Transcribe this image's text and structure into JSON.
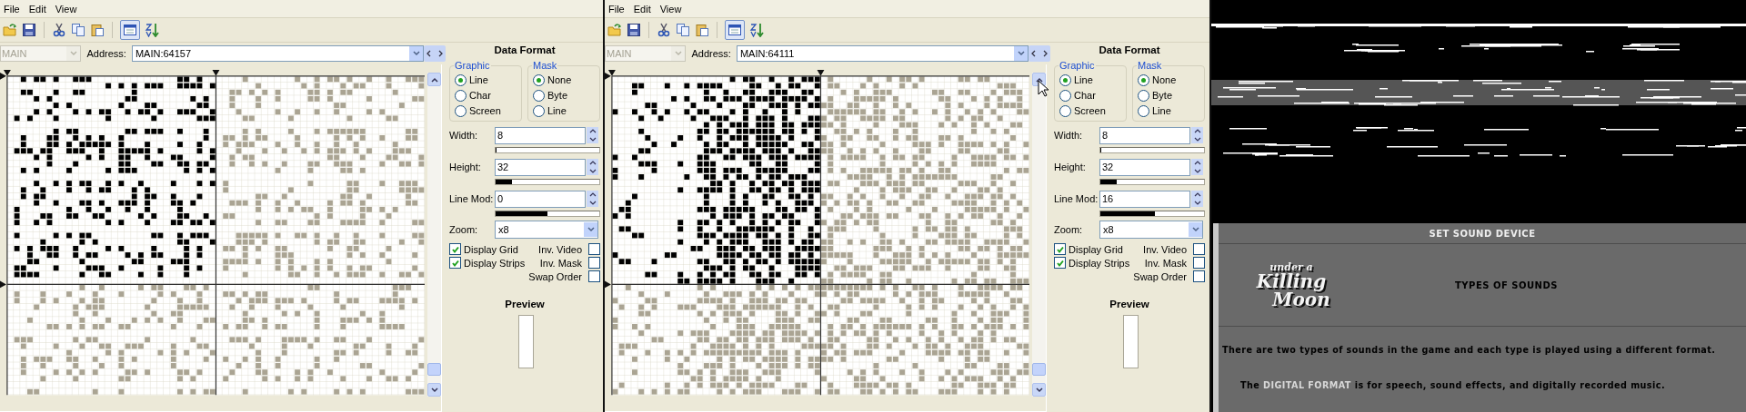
{
  "editors": [
    {
      "menu": [
        "File",
        "Edit",
        "View"
      ],
      "toolbar": {
        "view_toggle_pressed": true
      },
      "segment": {
        "value": "MAIN",
        "disabled": true
      },
      "address": {
        "label": "Address:",
        "value": "MAIN:64157"
      },
      "panel_title": "Data Format",
      "graphic": {
        "title": "Graphic",
        "options": [
          {
            "label": "Line",
            "selected": true
          },
          {
            "label": "Char",
            "selected": false
          },
          {
            "label": "Screen",
            "selected": false
          }
        ]
      },
      "mask": {
        "title": "Mask",
        "options": [
          {
            "label": "None",
            "selected": true
          },
          {
            "label": "Byte",
            "selected": false
          },
          {
            "label": "Line",
            "selected": false
          }
        ]
      },
      "fields": [
        {
          "label": "Width:",
          "value": "8",
          "level": 0.01
        },
        {
          "label": "Height:",
          "value": "32",
          "level": 0.16
        },
        {
          "label": "Line Mod:",
          "value": "0",
          "level": 0.5
        }
      ],
      "zoom": {
        "label": "Zoom:",
        "value": "x8"
      },
      "checks": [
        {
          "label": "Display Grid",
          "checked": true
        },
        {
          "label": "Inv. Video",
          "checked": false
        },
        {
          "label": "Display Strips",
          "checked": true
        },
        {
          "label": "Inv. Mask",
          "checked": false
        },
        {
          "label": "Swap Order",
          "checked": false
        }
      ],
      "preview": {
        "title": "Preview"
      },
      "cursor_shown": false
    },
    {
      "menu": [
        "File",
        "Edit",
        "View"
      ],
      "toolbar": {
        "view_toggle_pressed": true
      },
      "segment": {
        "value": "MAIN",
        "disabled": true
      },
      "address": {
        "label": "Address:",
        "value": "MAIN:64111"
      },
      "panel_title": "Data Format",
      "graphic": {
        "title": "Graphic",
        "options": [
          {
            "label": "Line",
            "selected": true
          },
          {
            "label": "Char",
            "selected": false
          },
          {
            "label": "Screen",
            "selected": false
          }
        ]
      },
      "mask": {
        "title": "Mask",
        "options": [
          {
            "label": "None",
            "selected": true
          },
          {
            "label": "Byte",
            "selected": false
          },
          {
            "label": "Line",
            "selected": false
          }
        ]
      },
      "fields": [
        {
          "label": "Width:",
          "value": "8",
          "level": 0.01
        },
        {
          "label": "Height:",
          "value": "32",
          "level": 0.16
        },
        {
          "label": "Line Mod:",
          "value": "16",
          "level": 0.53
        }
      ],
      "zoom": {
        "label": "Zoom:",
        "value": "x8"
      },
      "checks": [
        {
          "label": "Display Grid",
          "checked": true
        },
        {
          "label": "Inv. Video",
          "checked": false
        },
        {
          "label": "Display Strips",
          "checked": true
        },
        {
          "label": "Inv. Mask",
          "checked": false
        },
        {
          "label": "Swap Order",
          "checked": false
        }
      ],
      "preview": {
        "title": "Preview"
      },
      "cursor_shown": true
    }
  ],
  "game": {
    "title": "SET SOUND DEVICE",
    "logo": [
      "under a",
      "Killing",
      "Moon"
    ],
    "heading": "TYPES OF SOUNDS",
    "sentence": "There are two types of sounds in the game and each type is played using a different format.",
    "digital_line": [
      {
        "text": "The ",
        "highlight": false
      },
      {
        "text": "DIGITAL FORMAT",
        "highlight": true
      },
      {
        "text": " is for speech, sound effects, and digitally recorded music.",
        "highlight": false
      }
    ]
  }
}
